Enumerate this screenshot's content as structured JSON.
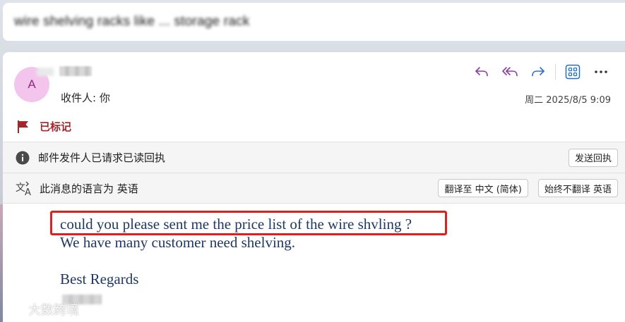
{
  "subject": {
    "text": "wire shelving racks like ... storage rack"
  },
  "sender": {
    "initial": "A"
  },
  "recipient": {
    "label": "收件人:",
    "value": "你"
  },
  "datetime": "周二 2025/8/5 9:09",
  "toolbar": {
    "icons": [
      "reply-icon",
      "reply-all-icon",
      "forward-icon",
      "apps-icon",
      "more-icon"
    ]
  },
  "flag": {
    "label": "已标记"
  },
  "read_receipt": {
    "text": "邮件发件人已请求已读回执",
    "button": "发送回执"
  },
  "translation": {
    "text": "此消息的语言为 英语",
    "translate_button": "翻译至 中文 (简体)",
    "never_button": "始终不翻译 英语"
  },
  "body": {
    "line1": "could you please sent me the price list of the wire shvling ?",
    "line2": "We have many customer need shelving.",
    "line3": "Best Regards"
  },
  "watermark": "大数跨境",
  "colors": {
    "accent": "#8a3ea0",
    "flag": "#a4262c",
    "body_text": "#1f3864",
    "highlight": "#e0201c",
    "avatar_bg": "#f3c5ec"
  }
}
